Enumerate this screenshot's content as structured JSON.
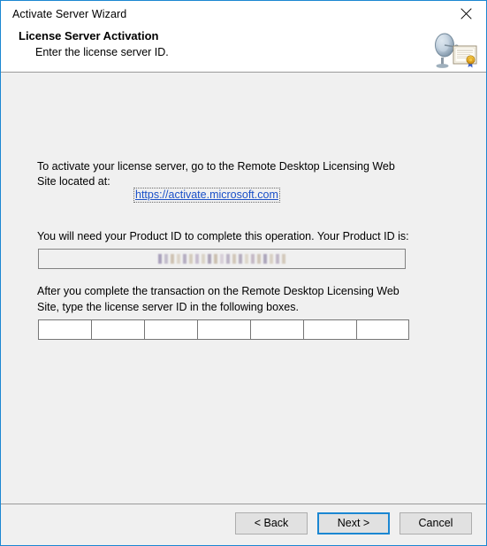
{
  "window": {
    "title": "Activate Server Wizard",
    "close_icon": "close-icon"
  },
  "header": {
    "title": "License Server Activation",
    "subtitle": "Enter the license server ID.",
    "icon": "satellite-dish-certificate-icon"
  },
  "body": {
    "intro_text": "To activate your license server, go to the Remote Desktop Licensing Web Site located at:",
    "link_text": "https://activate.microsoft.com",
    "product_id_label": "You will need your Product ID to complete this operation. Your Product ID is:",
    "product_id_value": "",
    "product_id_redacted": true,
    "instruction_text": "After you complete the transaction on the Remote Desktop Licensing Web Site, type the license server ID in the following boxes.",
    "license_id_boxes": [
      "",
      "",
      "",
      "",
      "",
      "",
      ""
    ]
  },
  "footer": {
    "back_label": "< Back",
    "next_label": "Next >",
    "cancel_label": "Cancel"
  },
  "colors": {
    "accent": "#1b87d2",
    "link": "#1a50c8",
    "body_bg": "#f0f0f0",
    "header_bg": "#ffffff"
  }
}
